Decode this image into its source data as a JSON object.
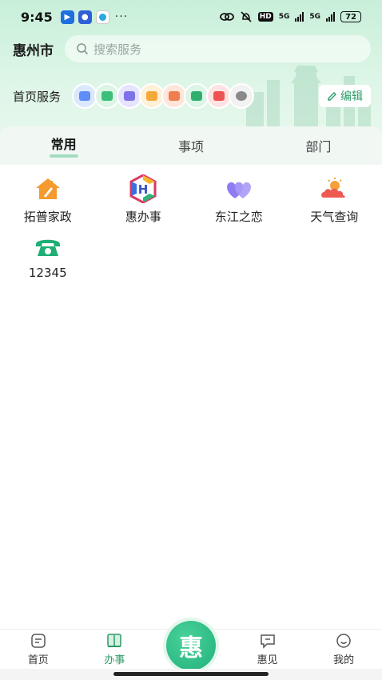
{
  "status_bar": {
    "time": "9:45",
    "more": "···",
    "hd": "HD",
    "net1": "5G",
    "net2": "5G",
    "battery": "72"
  },
  "header": {
    "city": "惠州市",
    "search_placeholder": "搜索服务"
  },
  "services": {
    "label": "首页服务",
    "edit_label": "编辑",
    "icons": [
      "calendar-icon",
      "chat-icon",
      "id-card-icon",
      "home-icon",
      "wallet-icon",
      "building-icon",
      "cart-icon",
      "globe-icon"
    ]
  },
  "tabs": [
    {
      "label": "常用",
      "active": true
    },
    {
      "label": "事项",
      "active": false
    },
    {
      "label": "部门",
      "active": false
    }
  ],
  "apps": [
    {
      "label": "拓普家政",
      "icon": "house-cleaning-icon"
    },
    {
      "label": "惠办事",
      "icon": "hui-ban-shi-logo-icon"
    },
    {
      "label": "东江之恋",
      "icon": "hearts-icon"
    },
    {
      "label": "天气查询",
      "icon": "weather-icon"
    },
    {
      "label": "12345",
      "icon": "telephone-icon"
    }
  ],
  "bottom_nav": {
    "items": [
      {
        "label": "首页",
        "icon": "home-doc-icon",
        "active": false
      },
      {
        "label": "办事",
        "icon": "book-icon",
        "active": true
      },
      {
        "label": "惠见",
        "icon": "message-icon",
        "active": false
      },
      {
        "label": "我的",
        "icon": "smile-icon",
        "active": false
      }
    ],
    "center_glyph": "惠"
  },
  "colors": {
    "accent": "#2e9a67",
    "header_bg": "#c8efd9"
  }
}
